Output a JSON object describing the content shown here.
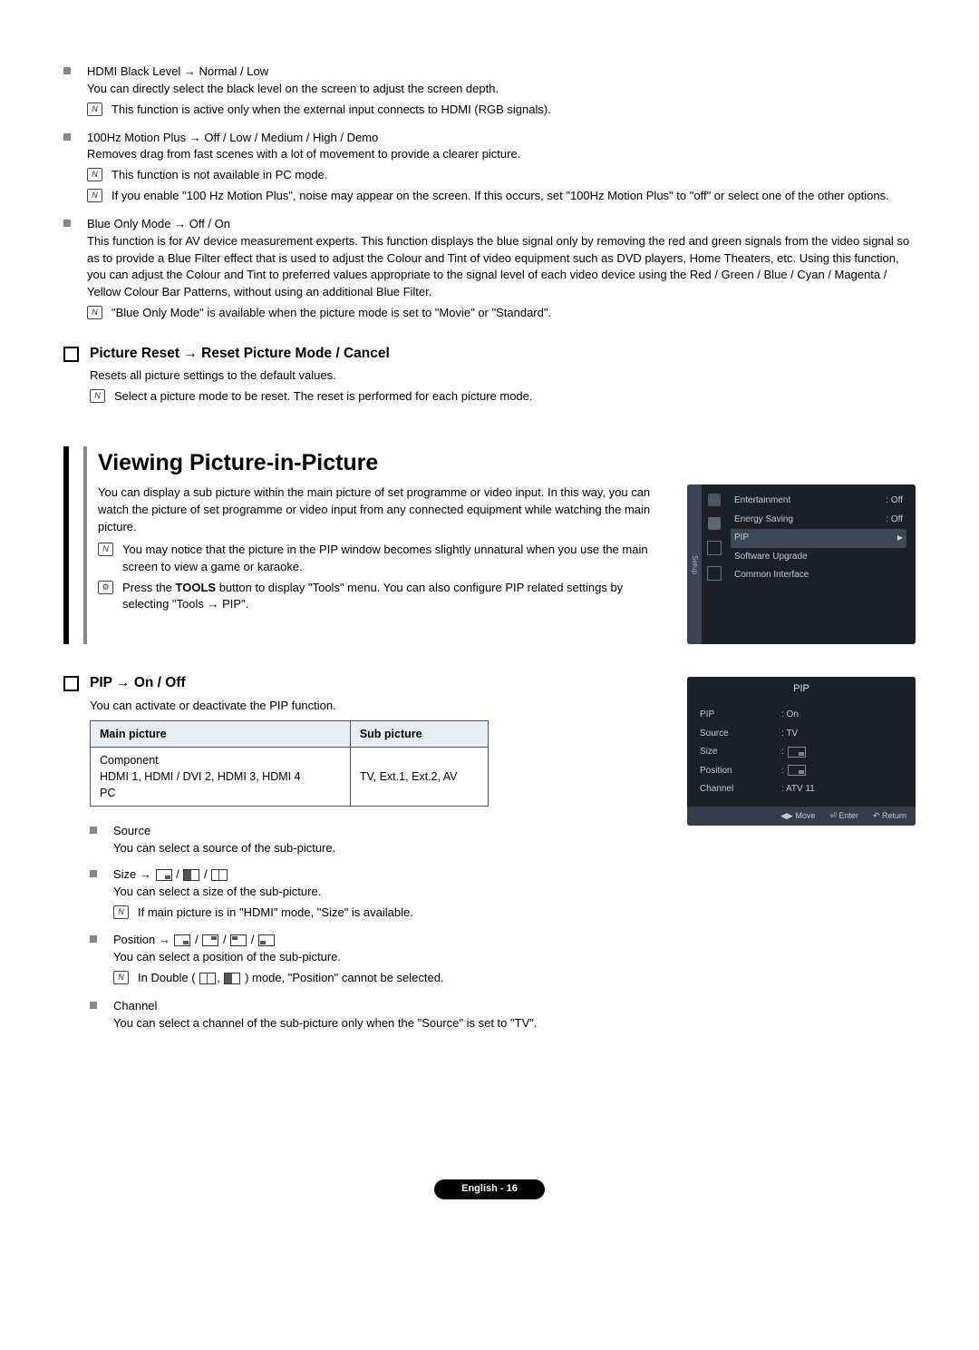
{
  "items": {
    "hdmi": {
      "title": "HDMI Black Level → Normal / Low",
      "desc": "You can directly select the black level on the screen to adjust the screen depth.",
      "note": "This function is active only when the external input connects to HDMI (RGB signals)."
    },
    "motion": {
      "title": "100Hz Motion Plus → Off / Low / Medium / High / Demo",
      "desc": "Removes drag from fast scenes with a lot of movement to provide a clearer picture.",
      "note1": "This function is not available in PC mode.",
      "note2": "If you enable \"100 Hz Motion Plus\", noise may appear on the screen. If this occurs, set \"100Hz Motion Plus\" to \"off\" or select one of the other options."
    },
    "blue": {
      "title": "Blue Only Mode → Off / On",
      "desc": "This function is for AV device measurement experts. This function displays the blue signal only by removing the red and green signals from the video signal so as to provide a Blue Filter effect that is used to adjust the Colour and Tint of video equipment such as DVD players, Home Theaters, etc. Using this function, you can adjust the Colour and Tint to preferred values appropriate to the signal level of each video device using the Red / Green / Blue / Cyan / Magenta / Yellow Colour Bar Patterns, without using an additional Blue Filter.",
      "note": "\"Blue Only Mode\" is available when the picture mode is set to \"Movie\" or \"Standard\"."
    }
  },
  "picture_reset": {
    "title": "Picture Reset → Reset Picture Mode / Cancel",
    "desc": "Resets all picture settings to the default values.",
    "note": "Select a picture mode to be reset. The reset is performed for each picture mode."
  },
  "h1": "Viewing Picture-in-Picture",
  "pip_intro": {
    "p1": "You can display a sub picture within the main picture of set programme or video input. In this way, you can watch the picture of set programme or video input from any connected equipment while watching the main picture.",
    "note": "You may notice that the picture in the PIP window becomes slightly unnatural when you use the main screen to view a game or karaoke.",
    "tool_pre": "Press the ",
    "tool_bold": "TOOLS",
    "tool_post": " button to display \"Tools\" menu. You can also configure PIP related settings by selecting \"Tools → PIP\"."
  },
  "pip": {
    "title": "PIP → On / Off",
    "desc": "You can activate or deactivate the PIP function.",
    "table": {
      "h1": "Main picture",
      "h2": "Sub picture",
      "c1a": "Component",
      "c1b": "HDMI 1, HDMI / DVI 2, HDMI 3, HDMI 4",
      "c1c": "PC",
      "c2": "TV, Ext.1, Ext.2, AV"
    },
    "source_t": "Source",
    "source_d": "You can select a source of the sub-picture.",
    "size_t": "Size → ",
    "size_d": "You can select a size of the sub-picture.",
    "size_n": "If main picture is in \"HDMI\" mode, \"Size\" is available.",
    "pos_t": "Position → ",
    "pos_d": "You can select a position of the sub-picture.",
    "pos_n_pre": "In Double ( ",
    "pos_n_post": " ) mode, \"Position\" cannot be selected.",
    "chan_t": "Channel",
    "chan_d": "You can select a channel of the sub-picture only when the \"Source\" is set to \"TV\"."
  },
  "osd1": {
    "tab": "Setup",
    "r1k": "Entertainment",
    "r1v": ": Off",
    "r2k": "Energy Saving",
    "r2v": ": Off",
    "r3k": "PIP",
    "r4k": "Software Upgrade",
    "r5k": "Common Interface"
  },
  "osd2": {
    "title": "PIP",
    "r1k": "PIP",
    "r1v": ": On",
    "r2k": "Source",
    "r2v": ": TV",
    "r3k": "Size",
    "r4k": "Position",
    "r5k": "Channel",
    "r5v": ": ATV 11",
    "f1": "Move",
    "f2": "Enter",
    "f3": "Return"
  },
  "footer": "English - 16"
}
